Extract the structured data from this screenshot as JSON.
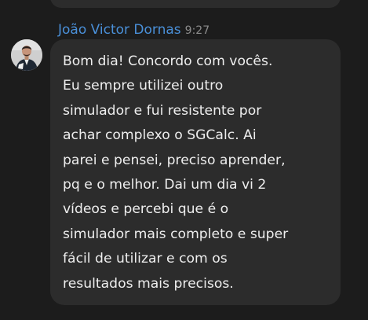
{
  "message": {
    "sender_name": "João Victor Dornas",
    "timestamp": "9:27",
    "text": "Bom dia! Concordo com vocês.\nEu sempre utilizei outro\nsimulador e fui resistente por\nachar complexo o SGCalc. Ai\nparei e pensei, preciso aprender,\npq e o melhor. Dai um dia vi 2\nvídeos e percebi que é o\nsimulador mais completo e super\nfácil de utilizar e com os\nresultados mais precisos."
  },
  "colors": {
    "background": "#1c1c1c",
    "bubble": "#2c2c2c",
    "sender_name": "#4a90d9",
    "timestamp": "#8c8c8c",
    "text": "#eeeeee"
  },
  "icons": {
    "avatar": "user-avatar-photo"
  }
}
